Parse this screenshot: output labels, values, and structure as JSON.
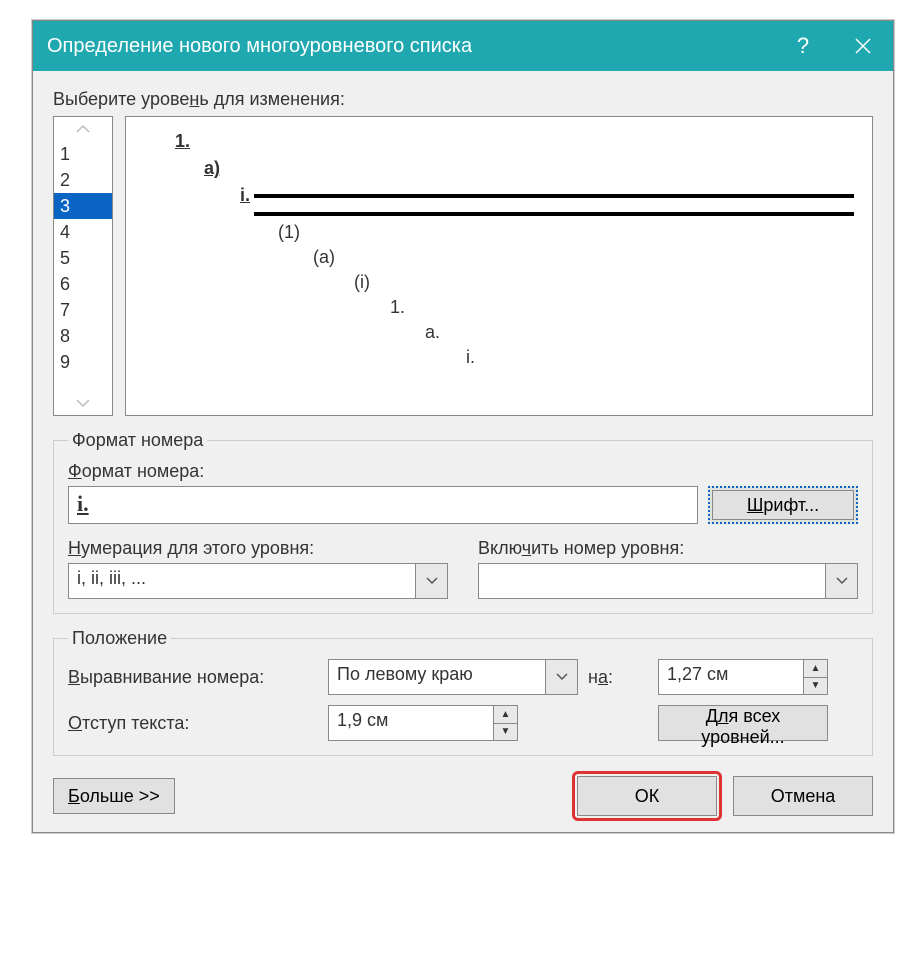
{
  "title": "Определение нового многоуровневого списка",
  "help_icon": "?",
  "close_icon": "×",
  "select_level_label": "Выберите уровень для изменения:",
  "levels": [
    "1",
    "2",
    "3",
    "4",
    "5",
    "6",
    "7",
    "8",
    "9"
  ],
  "selected_level_index": 2,
  "preview_markers": [
    "1.",
    "a)",
    "i.",
    "(1)",
    "(a)",
    "(i)",
    "1.",
    "a.",
    "i."
  ],
  "format_group": "Формат номера",
  "format_number_label": "Формат номера:",
  "format_number_value": "i.",
  "font_button": "Шрифт...",
  "numbering_label": "Нумерация для этого уровня:",
  "numbering_value": "i, ii, iii, ...",
  "include_label": "Включить номер уровня:",
  "include_value": "",
  "position_group": "Положение",
  "align_label": "Выравнивание номера:",
  "align_value": "По левому краю",
  "at_label": "на:",
  "at_value": "1,27 см",
  "indent_label": "Отступ текста:",
  "indent_value": "1,9 см",
  "all_levels_button": "Для всех уровней...",
  "more_button": "Больше >>",
  "ok_button": "ОК",
  "cancel_button": "Отмена"
}
